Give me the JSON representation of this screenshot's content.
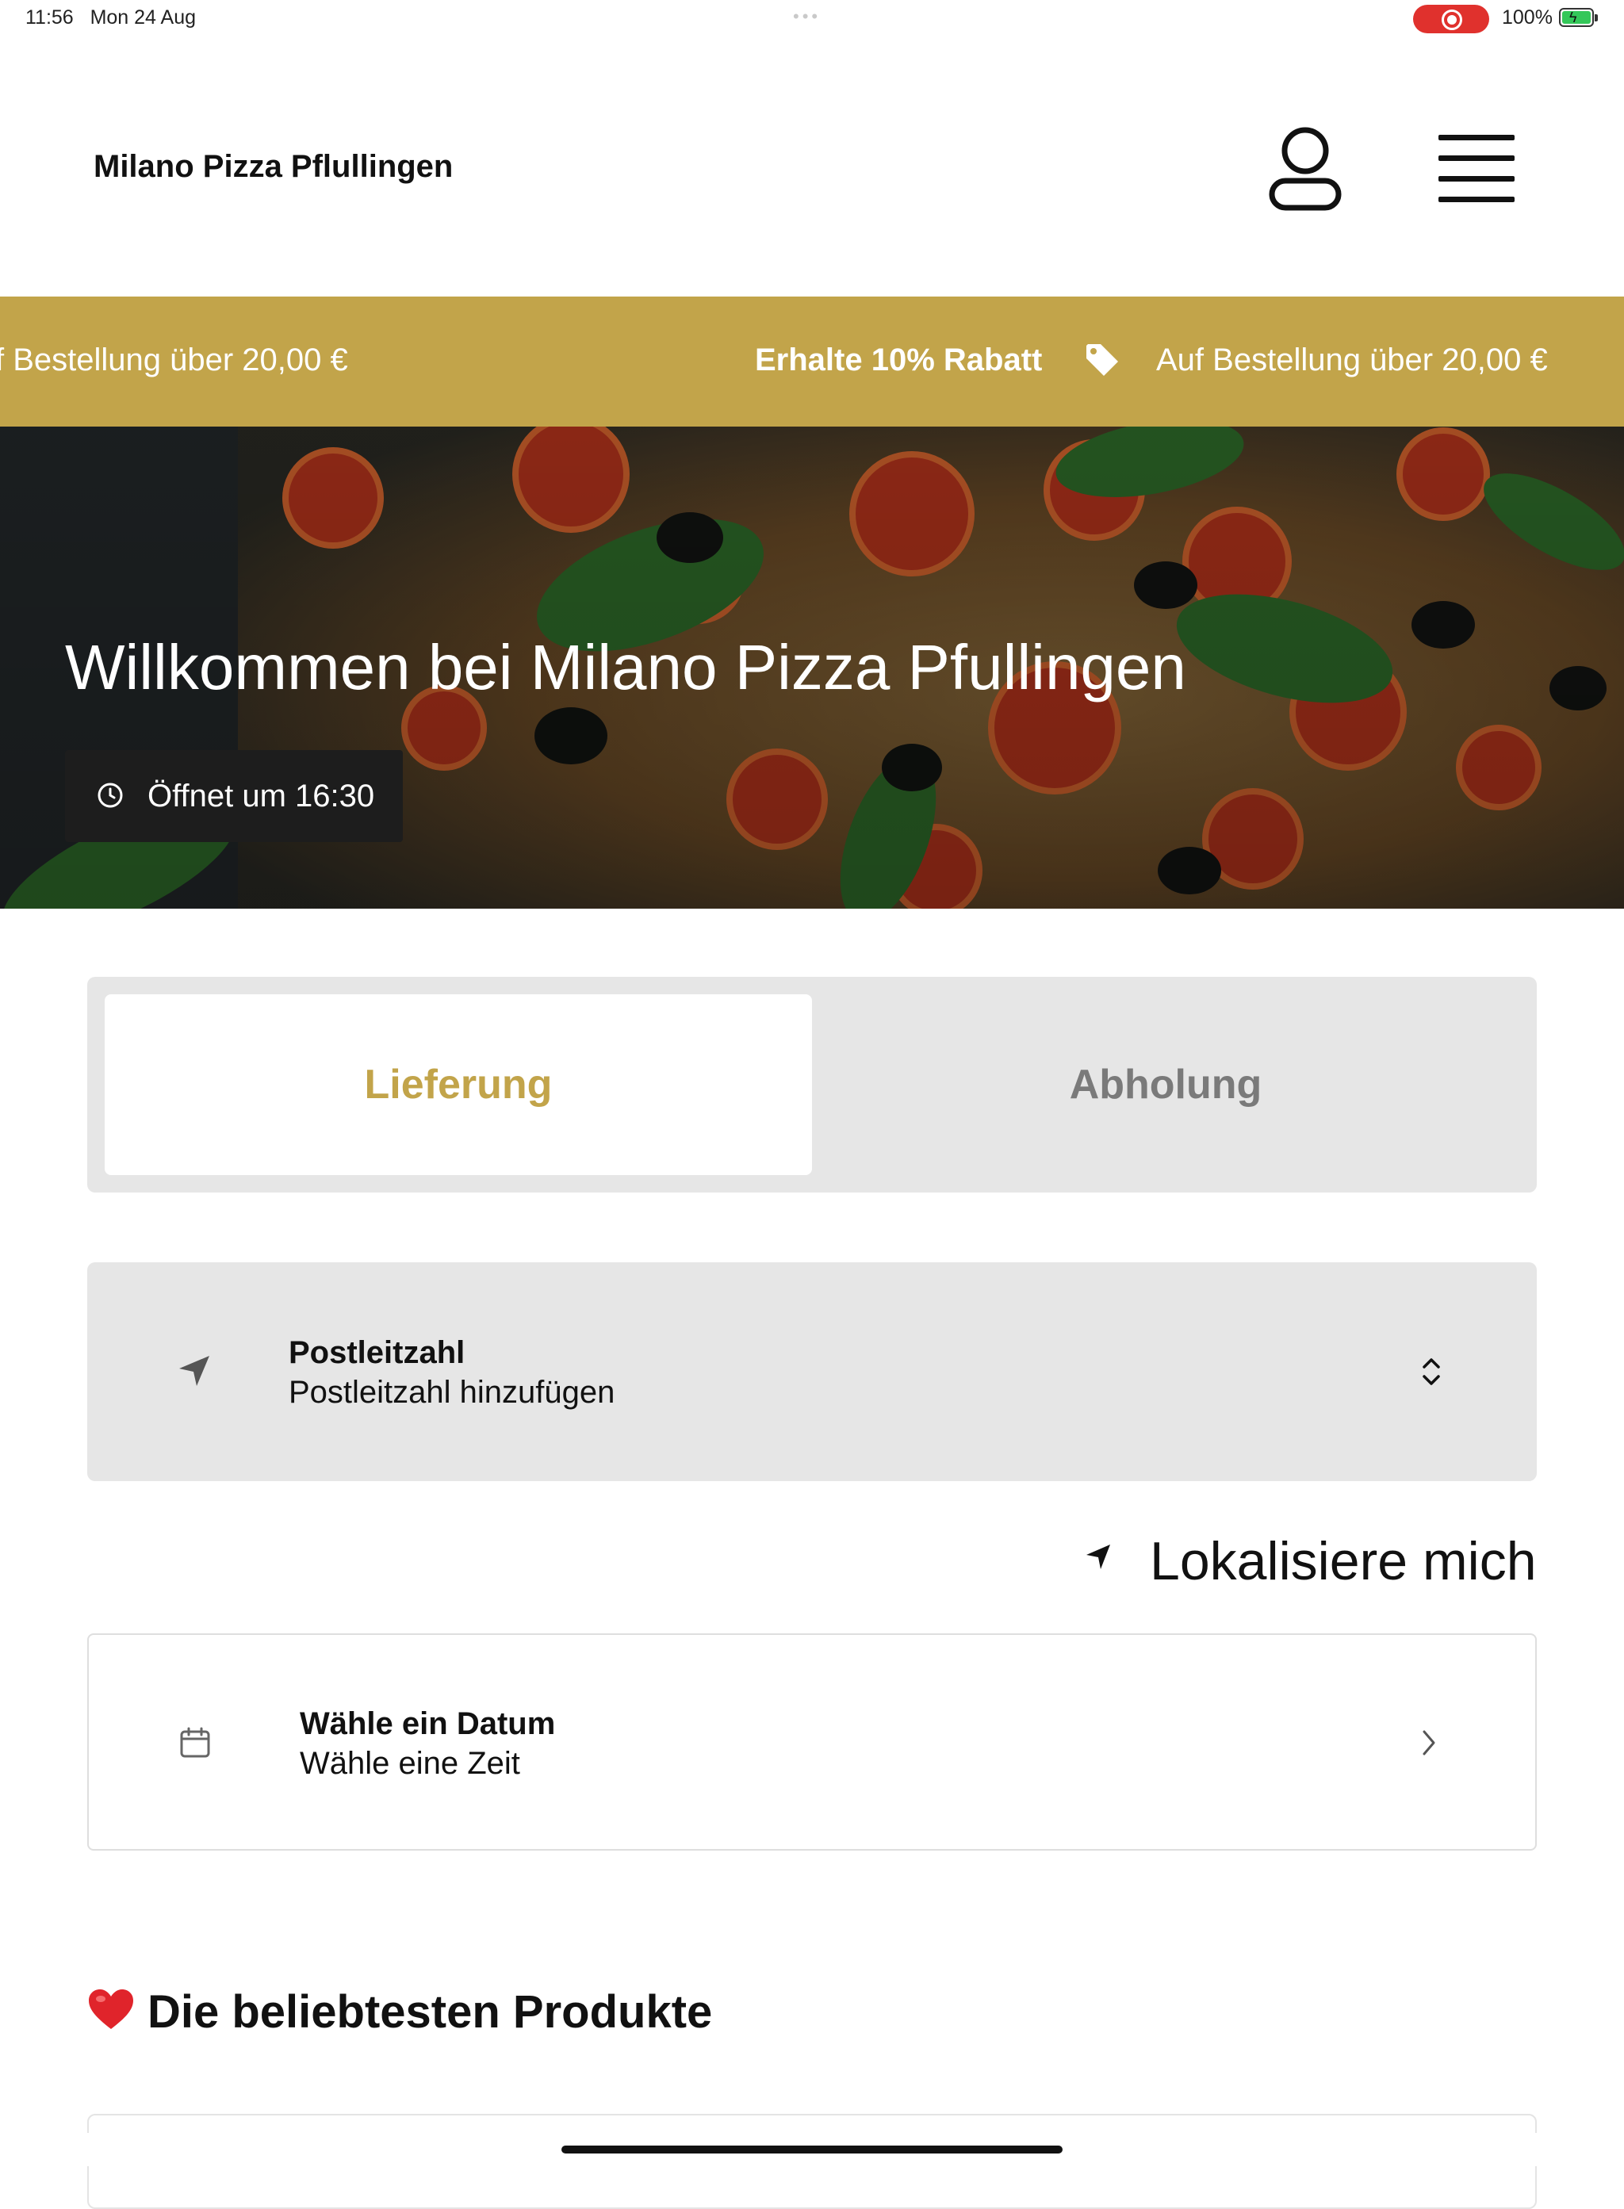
{
  "status_bar": {
    "time": "11:56",
    "date": "Mon 24 Aug",
    "dots": "•••",
    "battery_pct": "100%",
    "bolt": "ϟ"
  },
  "header": {
    "store_name": "Milano Pizza Pflullingen",
    "icons": [
      "account-icon",
      "menu-icon"
    ]
  },
  "promo": {
    "left_text": "f Bestellung über 20,00 €",
    "headline": "Erhalte 10% Rabatt",
    "right_text": "Auf Bestellung über 20,00 €",
    "icon": "tag-icon",
    "bg_color": "#c2a44a"
  },
  "hero": {
    "title": "Willkommen bei Milano Pizza Pfullingen",
    "hours": "Öffnet um 16:30",
    "icon": "clock-icon"
  },
  "mode": {
    "delivery": "Lieferung",
    "pickup": "Abholung",
    "selected": "delivery",
    "accent": "#c2a44a"
  },
  "postcode": {
    "title": "Postleitzahl",
    "placeholder": "Postleitzahl hinzufügen",
    "icon": "navigation-icon"
  },
  "locate": {
    "label": "Lokalisiere mich",
    "icon": "location-arrow-icon"
  },
  "schedule": {
    "title": "Wähle ein Datum",
    "subtitle": "Wähle eine Zeit",
    "icon": "calendar-icon"
  },
  "popular": {
    "title": "Die beliebtesten Produkte",
    "icon": "heart-icon"
  }
}
